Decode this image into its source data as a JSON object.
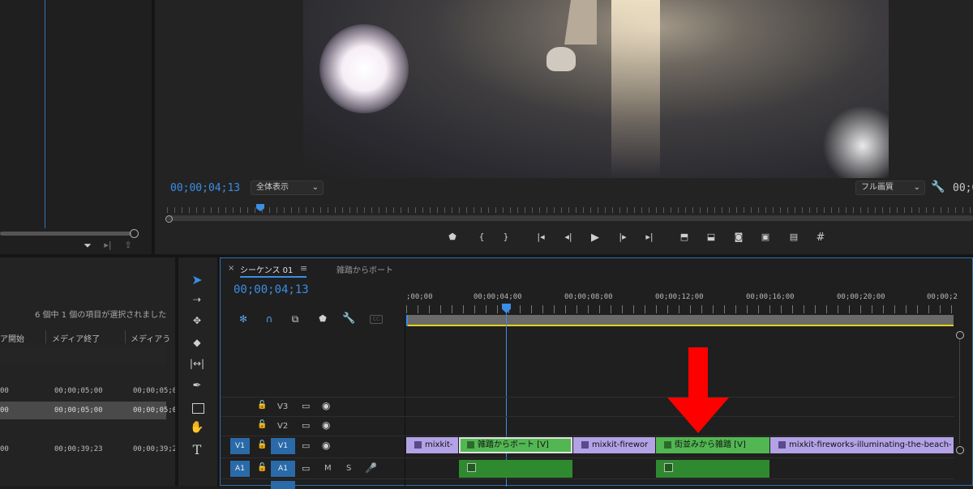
{
  "source_panel": {
    "filter_icons": [
      "filter-icon",
      "insert-icon",
      "export-icon"
    ]
  },
  "program_monitor": {
    "timecode": "00;00;04;13",
    "fit_label": "全体表示",
    "quality_label": "フル画質",
    "timecode_right": "00;0"
  },
  "transport": [
    "marker-icon",
    "in-point-icon",
    "out-point-icon",
    "go-to-in-icon",
    "step-back-icon",
    "play-icon",
    "step-forward-icon",
    "go-to-out-icon",
    "lift-icon",
    "extract-icon",
    "camera-icon",
    "comparison-icon",
    "trim-icon",
    "plus-icon"
  ],
  "project_panel": {
    "selection_info": "6 個中 1 個の項目が選択されました",
    "columns": [
      "ア開始",
      "メディア終了",
      "メディアう"
    ],
    "rows": [
      [
        "00",
        "00;00;05;00",
        "00;00;05;0"
      ],
      [
        "00",
        "00;00;05;00",
        "00;00;05;0"
      ],
      [
        "00",
        "00;00;39;23",
        "00;00;39;2"
      ]
    ]
  },
  "timeline": {
    "tab_close": "×",
    "tab_title": "シーケンス 01",
    "tab_menu": "≡",
    "tab_second": "雑踏からボート",
    "timecode": "00;00;04;13",
    "ruler_labels": [
      ";00;00",
      "00;00;04;00",
      "00;00;08;00",
      "00;00;12;00",
      "00;00;16;00",
      "00;00;20;00",
      "00;00;2"
    ],
    "tracks": [
      {
        "src": "",
        "name": "V3",
        "mute": "",
        "solo": ""
      },
      {
        "src": "",
        "name": "V2",
        "mute": "",
        "solo": ""
      },
      {
        "src": "V1",
        "name": "V1",
        "mute": "",
        "solo": ""
      },
      {
        "src": "A1",
        "name": "A1",
        "mute": "M",
        "solo": "S"
      }
    ],
    "video_clips": [
      {
        "label": "mixkit-",
        "color": "#b3a2e6"
      },
      {
        "label": "雑踏からボート [V]",
        "color": "#52b752"
      },
      {
        "label": "mixkit-firewor",
        "color": "#b3a2e6"
      },
      {
        "label": "街並みから雑踏 [V]",
        "color": "#52b752"
      },
      {
        "label": "mixkit-fireworks-illuminating-the-beach-",
        "color": "#b3a2e6"
      }
    ],
    "annotation_color": "#ff0000"
  }
}
